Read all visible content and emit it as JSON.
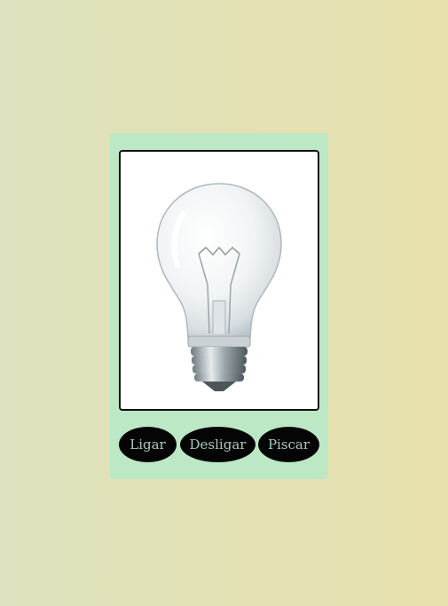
{
  "lamp": {
    "image_label": "lightbulb"
  },
  "controls": {
    "on_label": "Ligar",
    "off_label": "Desligar",
    "blink_label": "Piscar"
  },
  "colors": {
    "page_bg_left": "#dde1bd",
    "page_bg_right": "#e8e1ad",
    "card_bg": "#bde8c5",
    "button_bg": "#050505",
    "button_text": "#a9c9bd"
  }
}
